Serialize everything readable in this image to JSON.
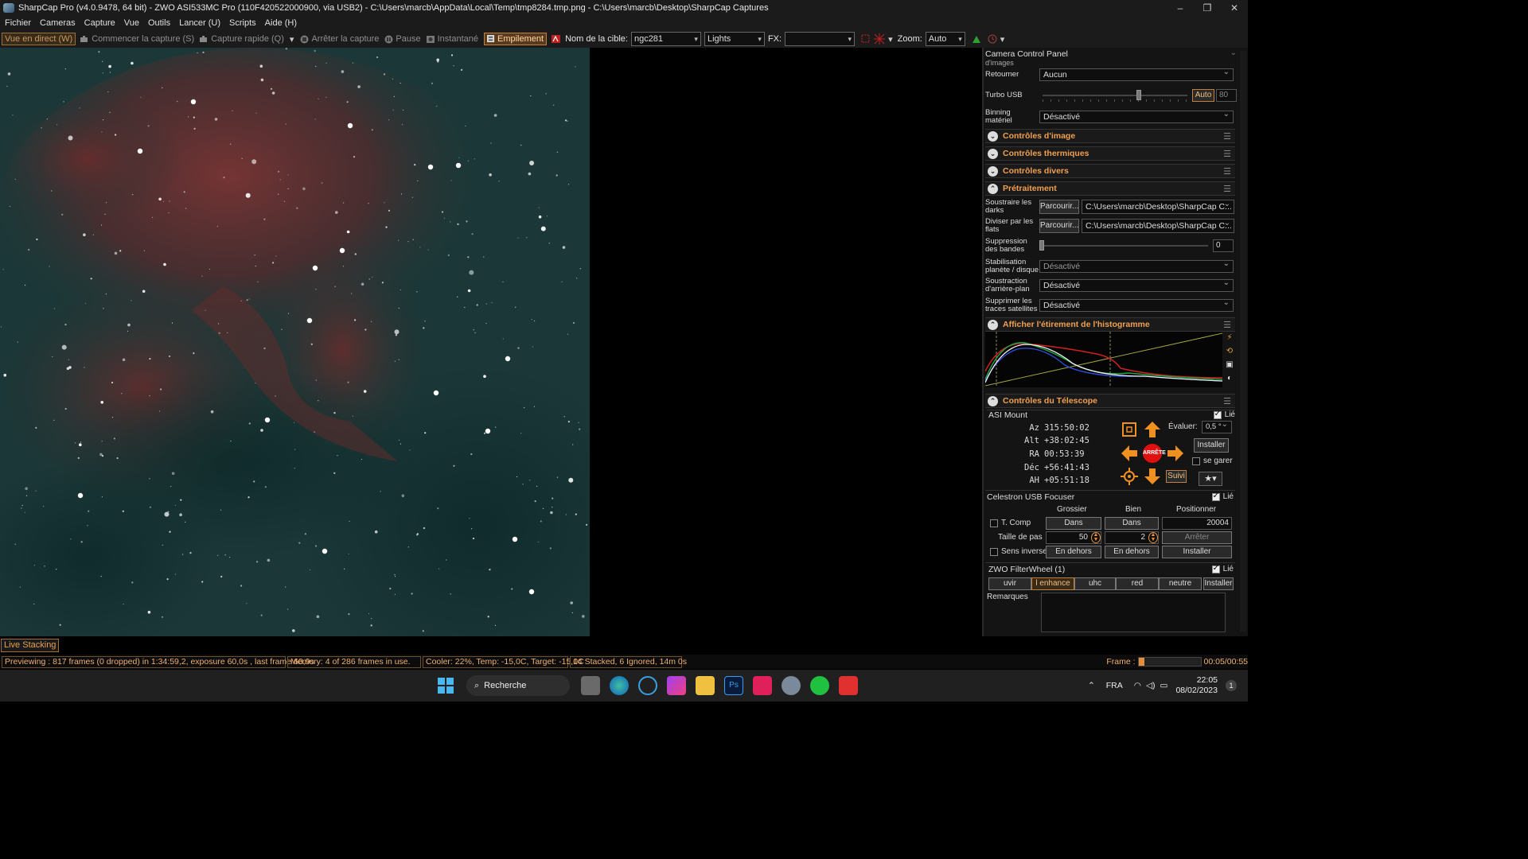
{
  "window": {
    "title": "SharpCap Pro (v4.0.9478, 64 bit) - ZWO ASI533MC Pro (110F420522000900, via USB2) - C:\\Users\\marcb\\AppData\\Local\\Temp\\tmp8284.tmp.png - C:\\Users\\marcb\\Desktop\\SharpCap Captures",
    "controls": [
      "–",
      "❐",
      "✕"
    ]
  },
  "menu": [
    "Fichier",
    "Cameras",
    "Capture",
    "Vue",
    "Outils",
    "Lancer (U)",
    "Scripts",
    "Aide (H)"
  ],
  "toolbar": {
    "live_view": "Vue en direct (W)",
    "start_capture": "Commencer la capture (S)",
    "quick_capture": "Capture rapide (Q)",
    "stop_capture": "Arrêter la capture",
    "pause": "Pause",
    "snapshot": "Instantané",
    "stacking": "Empilement",
    "target_label": "Nom de la cible:",
    "target_value": "ngc281",
    "frame_type": "Lights",
    "fx_label": "FX:",
    "fx_value": "",
    "zoom_label": "Zoom:",
    "zoom_value": "Auto"
  },
  "image_tab": "Live Stacking",
  "status": {
    "preview": "Previewing : 817 frames (0 dropped) in 1:34:59,2, exposure 60,0s , last frame 60,9s",
    "memory": "Memory: 4 of 286 frames in use.",
    "cooler": "Cooler: 22%, Temp: -15,0C, Target: -15,0C",
    "stacked": "14 Stacked, 6 Ignored, 14m 0s",
    "frame_label": "Frame :",
    "frame_time": "00:05/00:55",
    "frame_progress": 0.09
  },
  "panel": {
    "title": "Camera Control Panel",
    "partial_label": "d'images",
    "retourner_label": "Retourner",
    "retourner_value": "Aucun",
    "turbo_label": "Turbo USB",
    "turbo_auto": "Auto",
    "turbo_value": "80",
    "turbo_level": 0.67,
    "binning_label": "Binning matériel",
    "binning_value": "Désactivé",
    "sections": {
      "image": "Contrôles d'image",
      "thermal": "Contrôles thermiques",
      "misc": "Contrôles divers",
      "preprocess": "Prétraitement",
      "histogram": "Afficher l'étirement de l'histogramme",
      "telescope": "Contrôles du Télescope"
    },
    "darks_label": "Soustraire les darks",
    "darks_browse": "Parcourir...",
    "darks_path": "C:\\Users\\marcb\\Desktop\\SharpCap C...",
    "flats_label": "Diviser par les flats",
    "flats_browse": "Parcourir...",
    "flats_path": "C:\\Users\\marcb\\Desktop\\SharpCap C...",
    "banding_label": "Suppression des bandes",
    "banding_value": "0",
    "stab_label": "Stabilisation planète / disque",
    "stab_value": "Désactivé",
    "bg_label": "Soustraction d'arrière-plan",
    "bg_value": "Désactivé",
    "sat_label": "Supprimer les traces satellites",
    "sat_value": "Désactivé"
  },
  "mount": {
    "name": "ASI Mount",
    "linked": "Lié",
    "az_label": "Az",
    "az": "315:50:02",
    "alt_label": "Alt",
    "alt": "+38:02:45",
    "ra_label": "RA",
    "ra": "00:53:39",
    "dec_label": "Déc",
    "dec": "+56:41:43",
    "ah_label": "AH",
    "ah": "+05:51:18",
    "stop": "ARRÊTE",
    "rate_label": "Évaluer:",
    "rate_value": "0,5 °",
    "install": "Installer",
    "park": "se garer",
    "tracking": "Suivi"
  },
  "focuser": {
    "name": "Celestron USB Focuser",
    "linked": "Lié",
    "col_coarse": "Grossier",
    "col_fine": "Bien",
    "col_position": "Positionner",
    "tcomp": "T. Comp",
    "in_coarse": "Dans",
    "in_fine": "Dans",
    "position": "20004",
    "step_label": "Taille de pas",
    "step_coarse": "50",
    "step_fine": "2",
    "stop": "Arrêter",
    "reverse": "Sens inverse",
    "out_coarse": "En dehors",
    "out_fine": "En dehors",
    "install": "Installer"
  },
  "filterwheel": {
    "name": "ZWO FilterWheel (1)",
    "linked": "Lié",
    "filters": [
      "uvir",
      "l enhance",
      "uhc",
      "red",
      "neutre"
    ],
    "install": "Installer"
  },
  "notes_label": "Remarques",
  "taskbar": {
    "search": "Recherche",
    "lang": "FRA",
    "time": "22:05",
    "date": "08/02/2023",
    "notif": "1"
  }
}
